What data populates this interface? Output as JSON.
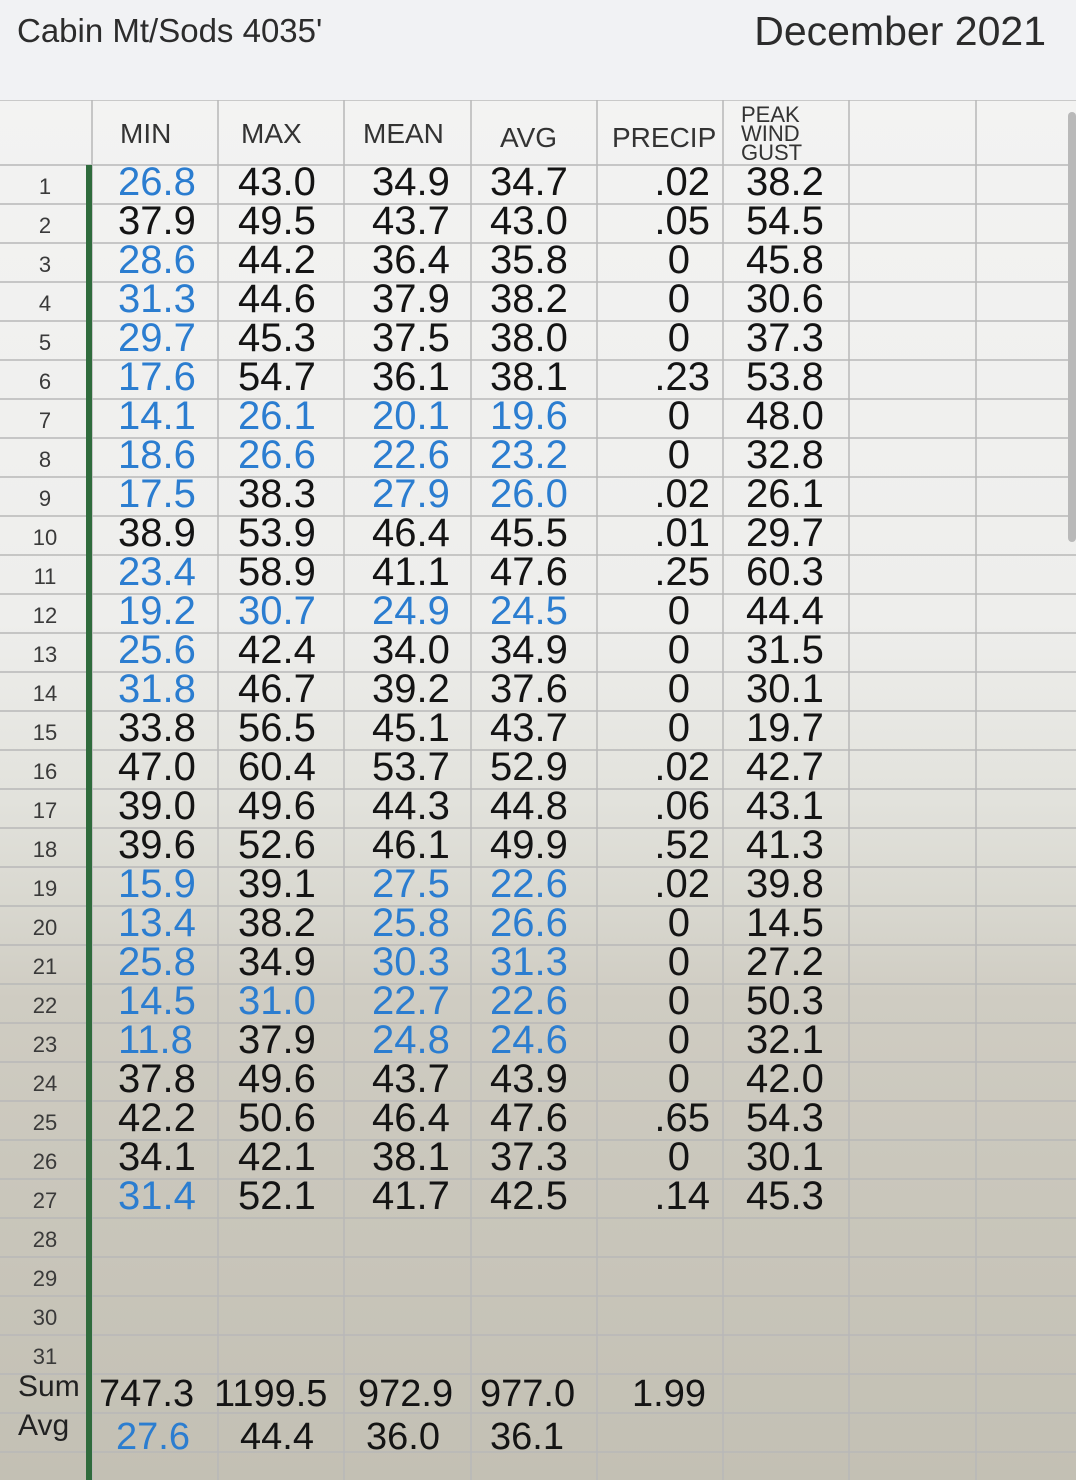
{
  "header": {
    "title": "Cabin Mt/Sods 4035'",
    "month": "December 2021"
  },
  "columns": [
    "MIN",
    "MAX",
    "MEAN",
    "AVG",
    "PRECIP",
    "PEAK WIND GUST"
  ],
  "rows": [
    {
      "day": "1",
      "min": "26.8",
      "max": "43.0",
      "mean": "34.9",
      "avg": "34.7",
      "precip": ".02",
      "gust": "38.2",
      "blue": [
        true,
        false,
        false,
        false
      ]
    },
    {
      "day": "2",
      "min": "37.9",
      "max": "49.5",
      "mean": "43.7",
      "avg": "43.0",
      "precip": ".05",
      "gust": "54.5",
      "blue": [
        false,
        false,
        false,
        false
      ]
    },
    {
      "day": "3",
      "min": "28.6",
      "max": "44.2",
      "mean": "36.4",
      "avg": "35.8",
      "precip": "0",
      "gust": "45.8",
      "blue": [
        true,
        false,
        false,
        false
      ]
    },
    {
      "day": "4",
      "min": "31.3",
      "max": "44.6",
      "mean": "37.9",
      "avg": "38.2",
      "precip": "0",
      "gust": "30.6",
      "blue": [
        true,
        false,
        false,
        false
      ]
    },
    {
      "day": "5",
      "min": "29.7",
      "max": "45.3",
      "mean": "37.5",
      "avg": "38.0",
      "precip": "0",
      "gust": "37.3",
      "blue": [
        true,
        false,
        false,
        false
      ]
    },
    {
      "day": "6",
      "min": "17.6",
      "max": "54.7",
      "mean": "36.1",
      "avg": "38.1",
      "precip": ".23",
      "gust": "53.8",
      "blue": [
        true,
        false,
        false,
        false
      ]
    },
    {
      "day": "7",
      "min": "14.1",
      "max": "26.1",
      "mean": "20.1",
      "avg": "19.6",
      "precip": "0",
      "gust": "48.0",
      "blue": [
        true,
        true,
        true,
        true
      ]
    },
    {
      "day": "8",
      "min": "18.6",
      "max": "26.6",
      "mean": "22.6",
      "avg": "23.2",
      "precip": "0",
      "gust": "32.8",
      "blue": [
        true,
        true,
        true,
        true
      ]
    },
    {
      "day": "9",
      "min": "17.5",
      "max": "38.3",
      "mean": "27.9",
      "avg": "26.0",
      "precip": ".02",
      "gust": "26.1",
      "blue": [
        true,
        false,
        true,
        true
      ]
    },
    {
      "day": "10",
      "min": "38.9",
      "max": "53.9",
      "mean": "46.4",
      "avg": "45.5",
      "precip": ".01",
      "gust": "29.7",
      "blue": [
        false,
        false,
        false,
        false
      ]
    },
    {
      "day": "11",
      "min": "23.4",
      "max": "58.9",
      "mean": "41.1",
      "avg": "47.6",
      "precip": ".25",
      "gust": "60.3",
      "blue": [
        true,
        false,
        false,
        false
      ]
    },
    {
      "day": "12",
      "min": "19.2",
      "max": "30.7",
      "mean": "24.9",
      "avg": "24.5",
      "precip": "0",
      "gust": "44.4",
      "blue": [
        true,
        true,
        true,
        true
      ]
    },
    {
      "day": "13",
      "min": "25.6",
      "max": "42.4",
      "mean": "34.0",
      "avg": "34.9",
      "precip": "0",
      "gust": "31.5",
      "blue": [
        true,
        false,
        false,
        false
      ]
    },
    {
      "day": "14",
      "min": "31.8",
      "max": "46.7",
      "mean": "39.2",
      "avg": "37.6",
      "precip": "0",
      "gust": "30.1",
      "blue": [
        true,
        false,
        false,
        false
      ]
    },
    {
      "day": "15",
      "min": "33.8",
      "max": "56.5",
      "mean": "45.1",
      "avg": "43.7",
      "precip": "0",
      "gust": "19.7",
      "blue": [
        false,
        false,
        false,
        false
      ]
    },
    {
      "day": "16",
      "min": "47.0",
      "max": "60.4",
      "mean": "53.7",
      "avg": "52.9",
      "precip": ".02",
      "gust": "42.7",
      "blue": [
        false,
        false,
        false,
        false
      ]
    },
    {
      "day": "17",
      "min": "39.0",
      "max": "49.6",
      "mean": "44.3",
      "avg": "44.8",
      "precip": ".06",
      "gust": "43.1",
      "blue": [
        false,
        false,
        false,
        false
      ]
    },
    {
      "day": "18",
      "min": "39.6",
      "max": "52.6",
      "mean": "46.1",
      "avg": "49.9",
      "precip": ".52",
      "gust": "41.3",
      "blue": [
        false,
        false,
        false,
        false
      ]
    },
    {
      "day": "19",
      "min": "15.9",
      "max": "39.1",
      "mean": "27.5",
      "avg": "22.6",
      "precip": ".02",
      "gust": "39.8",
      "blue": [
        true,
        false,
        true,
        true
      ]
    },
    {
      "day": "20",
      "min": "13.4",
      "max": "38.2",
      "mean": "25.8",
      "avg": "26.6",
      "precip": "0",
      "gust": "14.5",
      "blue": [
        true,
        false,
        true,
        true
      ]
    },
    {
      "day": "21",
      "min": "25.8",
      "max": "34.9",
      "mean": "30.3",
      "avg": "31.3",
      "precip": "0",
      "gust": "27.2",
      "blue": [
        true,
        false,
        true,
        true
      ]
    },
    {
      "day": "22",
      "min": "14.5",
      "max": "31.0",
      "mean": "22.7",
      "avg": "22.6",
      "precip": "0",
      "gust": "50.3",
      "blue": [
        true,
        true,
        true,
        true
      ]
    },
    {
      "day": "23",
      "min": "11.8",
      "max": "37.9",
      "mean": "24.8",
      "avg": "24.6",
      "precip": "0",
      "gust": "32.1",
      "blue": [
        true,
        false,
        true,
        true
      ]
    },
    {
      "day": "24",
      "min": "37.8",
      "max": "49.6",
      "mean": "43.7",
      "avg": "43.9",
      "precip": "0",
      "gust": "42.0",
      "blue": [
        false,
        false,
        false,
        false
      ]
    },
    {
      "day": "25",
      "min": "42.2",
      "max": "50.6",
      "mean": "46.4",
      "avg": "47.6",
      "precip": ".65",
      "gust": "54.3",
      "blue": [
        false,
        false,
        false,
        false
      ]
    },
    {
      "day": "26",
      "min": "34.1",
      "max": "42.1",
      "mean": "38.1",
      "avg": "37.3",
      "precip": "0",
      "gust": "30.1",
      "blue": [
        false,
        false,
        false,
        false
      ]
    },
    {
      "day": "27",
      "min": "31.4",
      "max": "52.1",
      "mean": "41.7",
      "avg": "42.5",
      "precip": ".14",
      "gust": "45.3",
      "blue": [
        true,
        false,
        false,
        false
      ]
    },
    {
      "day": "28",
      "min": "",
      "max": "",
      "mean": "",
      "avg": "",
      "precip": "",
      "gust": "",
      "blue": [
        false,
        false,
        false,
        false
      ]
    },
    {
      "day": "29",
      "min": "",
      "max": "",
      "mean": "",
      "avg": "",
      "precip": "",
      "gust": "",
      "blue": [
        false,
        false,
        false,
        false
      ]
    },
    {
      "day": "30",
      "min": "",
      "max": "",
      "mean": "",
      "avg": "",
      "precip": "",
      "gust": "",
      "blue": [
        false,
        false,
        false,
        false
      ]
    },
    {
      "day": "31",
      "min": "",
      "max": "",
      "mean": "",
      "avg": "",
      "precip": "",
      "gust": "",
      "blue": [
        false,
        false,
        false,
        false
      ]
    }
  ],
  "sum": {
    "label": "Sum",
    "min": "747.3",
    "max": "1199.5",
    "mean": "972.9",
    "avg": "977.0",
    "precip": "1.99"
  },
  "avg": {
    "label": "Avg",
    "min": "27.6",
    "max": "44.4",
    "mean": "36.0",
    "avg": "36.1",
    "min_blue": true
  },
  "colors": {
    "blue_value": "#2b7dd0",
    "text": "#141414",
    "row_bar": "#2f6b3c"
  }
}
